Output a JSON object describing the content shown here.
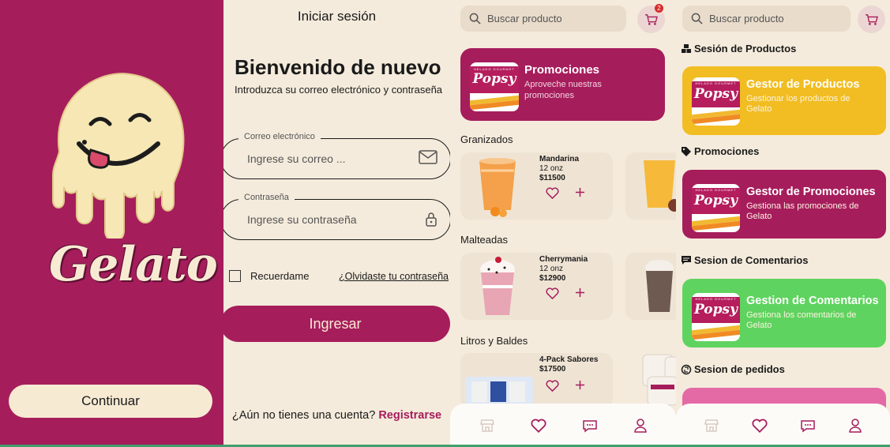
{
  "splash": {
    "logo_text": "Gelato",
    "continue_label": "Continuar"
  },
  "login": {
    "screen_title": "Iniciar sesión",
    "welcome": "Bienvenido de nuevo",
    "subtitle": "Introduzca su correo electrónico y contraseña",
    "email_label": "Correo electrónico",
    "email_placeholder": "Ingrese su correo ...",
    "password_label": "Contraseña",
    "password_placeholder": "Ingrese su contraseña",
    "remember_label": "Recuerdame",
    "forgot_label": "¿Olvidaste tu contraseña",
    "login_label": "Ingresar",
    "register_prompt": "¿Aún no tienes una cuenta?",
    "register_label": "Registrarse"
  },
  "catalog": {
    "search_placeholder": "Buscar producto",
    "cart_count": "2",
    "promo": {
      "title": "Promociones",
      "desc": "Aproveche nuestras promociones"
    },
    "sections": [
      {
        "title": "Granizados",
        "product": {
          "name": "Mandarina",
          "size": "12 onz",
          "price": "$11500"
        }
      },
      {
        "title": "Malteadas",
        "product": {
          "name": "Cherrymania",
          "size": "12 onz",
          "price": "$12900"
        }
      },
      {
        "title": "Litros y Baldes",
        "product": {
          "name": "4-Pack Sabores",
          "size": "",
          "price": "$17500"
        }
      }
    ],
    "nav": [
      "store-icon",
      "heart-icon",
      "chat-icon",
      "user-icon"
    ]
  },
  "admin": {
    "search_placeholder": "Buscar producto",
    "sections": [
      {
        "title": "Sesión de Productos",
        "card_title": "Gestor de Productos",
        "card_desc": "Gestionar los productos de Gelato",
        "color": "#f1bd22"
      },
      {
        "title": "Promociones",
        "card_title": "Gestor de Promociones",
        "card_desc": "Gestiona las promociones de Gelato",
        "color": "#a61d5c"
      },
      {
        "title": "Sesion de Comentarios",
        "card_title": "Gestion de Comentarios",
        "card_desc": "Gestiona los comentarios de Gelato",
        "color": "#5fd35f"
      },
      {
        "title": "Sesion de pedidos",
        "color": "#e46aa5"
      }
    ]
  },
  "brand": {
    "word": "Popsy",
    "tagline": "HELADO GOURMET"
  },
  "colors": {
    "primary": "#a61d5c",
    "cream": "#f4ebdc",
    "yellow": "#f1bd22",
    "green": "#5fd35f"
  }
}
